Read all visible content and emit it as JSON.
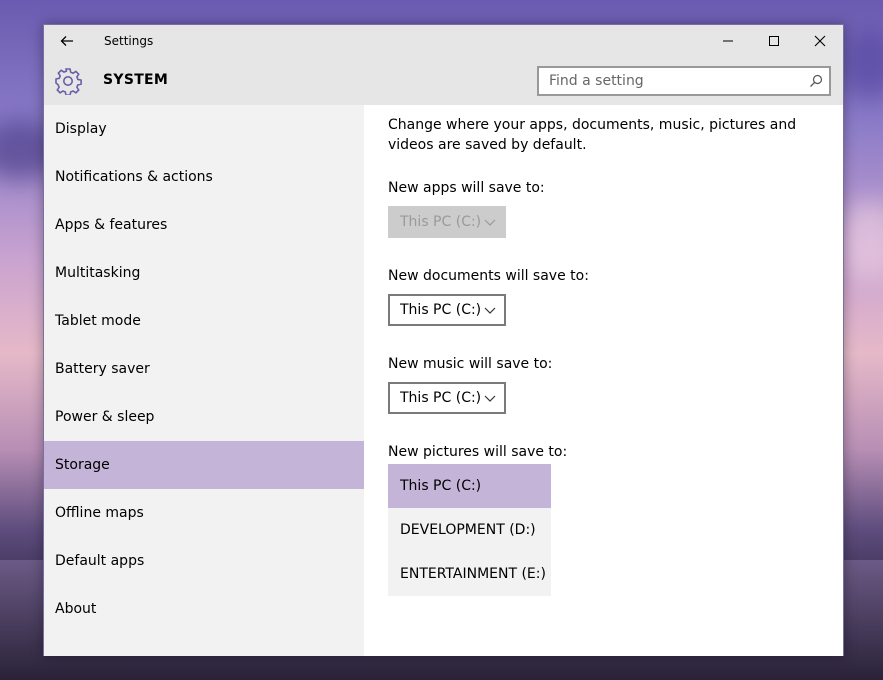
{
  "window": {
    "title": "Settings"
  },
  "header": {
    "section": "SYSTEM",
    "search_placeholder": "Find a setting"
  },
  "sidebar": {
    "items": [
      {
        "label": "Display"
      },
      {
        "label": "Notifications & actions"
      },
      {
        "label": "Apps & features"
      },
      {
        "label": "Multitasking"
      },
      {
        "label": "Tablet mode"
      },
      {
        "label": "Battery saver"
      },
      {
        "label": "Power & sleep"
      },
      {
        "label": "Storage",
        "selected": true
      },
      {
        "label": "Offline maps"
      },
      {
        "label": "Default apps"
      },
      {
        "label": "About"
      }
    ]
  },
  "content": {
    "intro": "Change where your apps, documents, music, pictures and videos are saved by default.",
    "apps": {
      "label": "New apps will save to:",
      "value": "This PC (C:)",
      "disabled": true
    },
    "documents": {
      "label": "New documents will save to:",
      "value": "This PC (C:)"
    },
    "music": {
      "label": "New music will save to:",
      "value": "This PC (C:)"
    },
    "pictures": {
      "label": "New pictures will save to:",
      "options": [
        "This PC (C:)",
        "DEVELOPMENT (D:)",
        "ENTERTAINMENT (E:)"
      ],
      "selected_index": 0
    }
  },
  "colors": {
    "accent": "#c3b4d8",
    "sidebar_bg": "#f2f2f2",
    "titlebar_bg": "#e6e6e6",
    "gear": "#6b5ea8"
  }
}
